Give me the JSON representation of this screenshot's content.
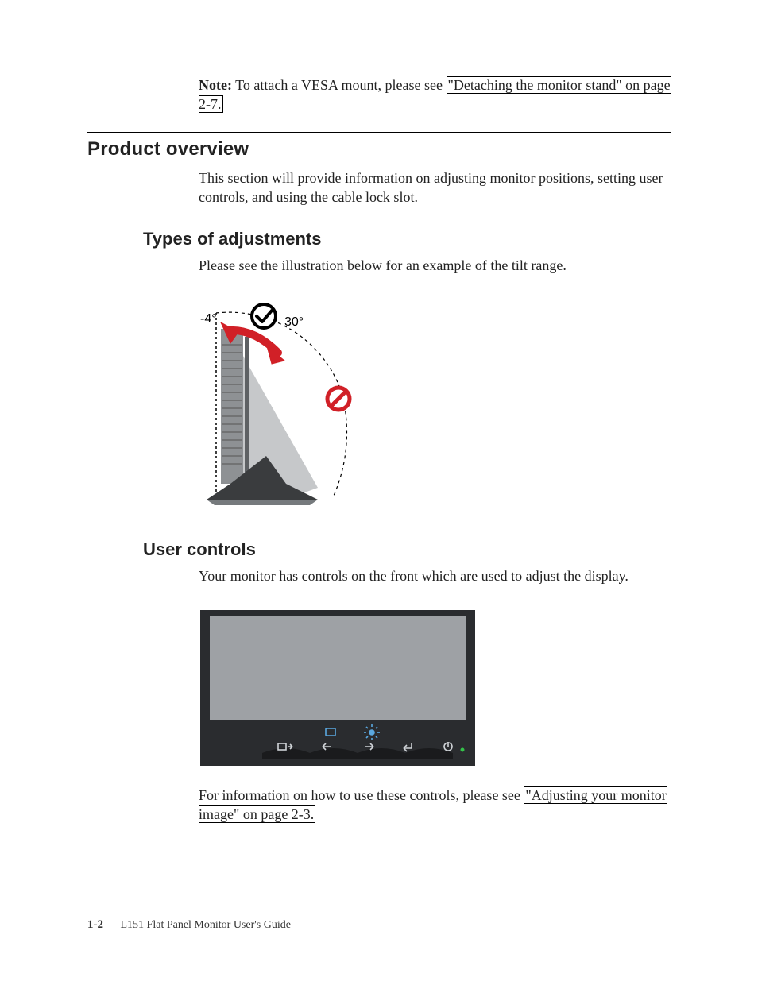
{
  "note": {
    "label": "Note:",
    "before_link": " To attach a VESA mount, please see ",
    "link": "\"Detaching the monitor stand\" on page 2-7."
  },
  "section": {
    "title": "Product overview",
    "intro": "This section will provide information on adjusting monitor positions, setting user controls, and using the cable lock slot."
  },
  "adjustments": {
    "title": "Types of adjustments",
    "text": "Please see the illustration below for an example of the tilt range.",
    "angle_neg": "-4°",
    "angle_pos": "30°"
  },
  "user_controls": {
    "title": "User controls",
    "intro": "Your monitor has controls on the front which are used to adjust the display.",
    "after_before": "For information on how to use these controls, please see ",
    "after_link": "\"Adjusting your monitor image\" on page 2-3."
  },
  "footer": {
    "page": "1-2",
    "title": "L151 Flat Panel Monitor User's Guide"
  }
}
